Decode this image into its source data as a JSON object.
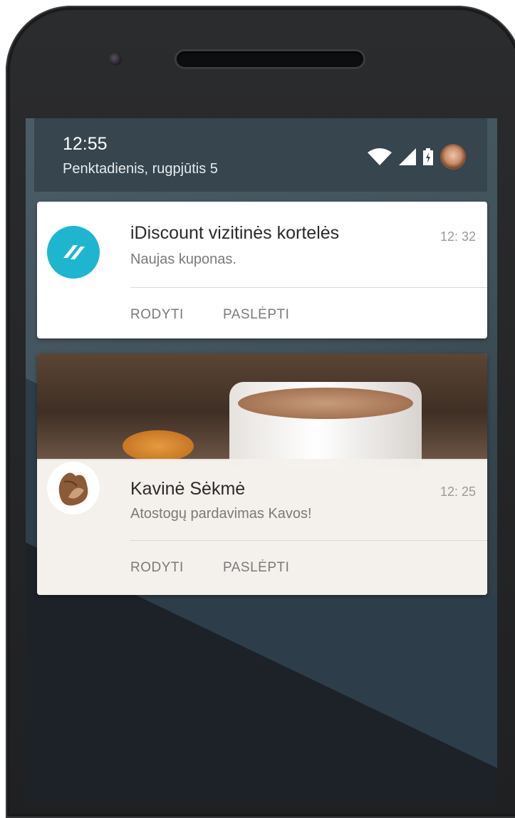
{
  "status_bar": {
    "time": "12:55",
    "date": "Penktadienis, rugpjūtis 5",
    "icons": [
      "wifi-icon",
      "cell-signal-icon",
      "battery-charging-icon"
    ]
  },
  "notifications": [
    {
      "app_icon": "idiscount-logo-icon",
      "icon_color": "#1eb6cf",
      "title": "iDiscount vizitinės kortelės",
      "text": "Naujas kuponas.",
      "time": "12: 32",
      "actions": [
        "RODYTI",
        "PASLĖPTI"
      ]
    },
    {
      "app_icon": "coffee-bean-icon",
      "title": "Kavinė Sėkmė",
      "text": "Atostogų pardavimas Kavos!",
      "time": "12: 25",
      "actions": [
        "RODYTI",
        "PASLĖPTI"
      ]
    }
  ]
}
